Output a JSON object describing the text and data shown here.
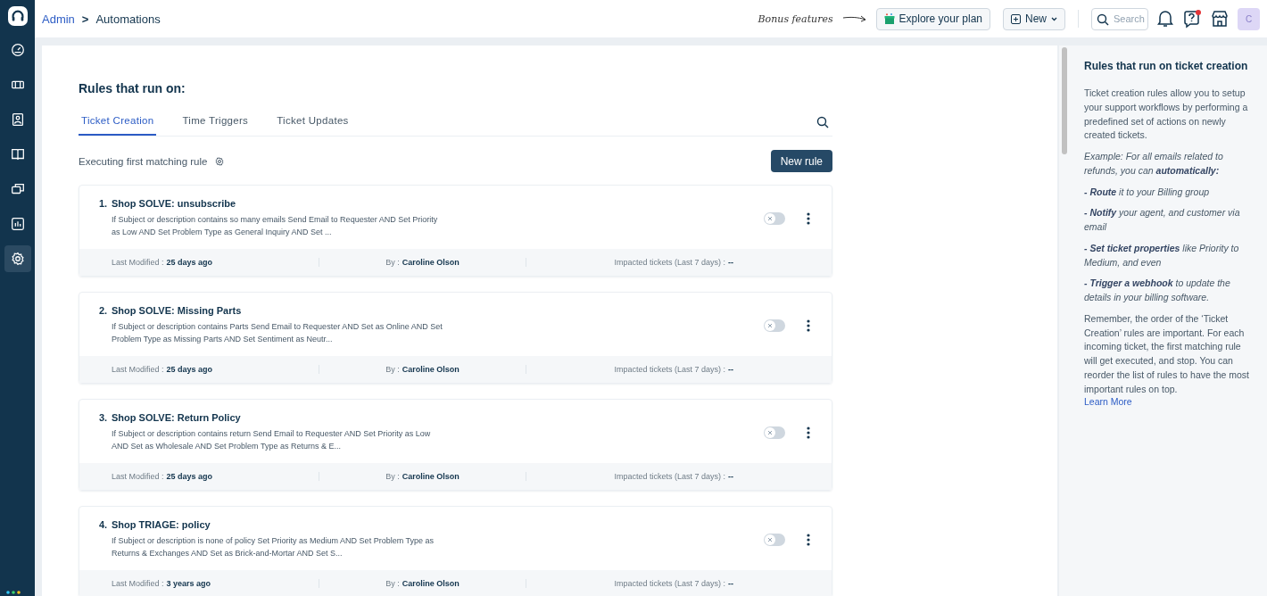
{
  "sidebar": {
    "items": [
      {
        "selected": false
      },
      {
        "selected": false
      },
      {
        "selected": false
      },
      {
        "selected": false
      },
      {
        "selected": false
      },
      {
        "selected": false
      },
      {
        "selected": true
      }
    ]
  },
  "breadcrumb": {
    "parent": "Admin",
    "separator": ">",
    "current": "Automations"
  },
  "header": {
    "hint": "Bonus features",
    "explore_button": "Explore your plan",
    "new_button": "New",
    "search": {
      "placeholder": "Search"
    },
    "help_badge": true,
    "avatar": "C"
  },
  "main": {
    "heading": "Rules that run on:",
    "tabs": [
      {
        "label": "Ticket Creation",
        "selected": true
      },
      {
        "label": "Time Triggers",
        "selected": false
      },
      {
        "label": "Ticket Updates",
        "selected": false
      }
    ],
    "mode": "Executing first matching rule",
    "new_rule_button": "New rule",
    "rules": [
      {
        "number": "1.",
        "name": "Shop SOLVE: unsubscribe",
        "description": "If Subject or description contains so many emails Send Email to Requester AND Set Priority as Low AND Set Problem Type as General Inquiry AND Set ...",
        "on": false,
        "modified_label": "Last Modified :",
        "modified": "25 days ago",
        "by_label": "By :",
        "by": "Caroline Olson",
        "impact_label": "Impacted tickets (Last 7 days) :",
        "impact": "--"
      },
      {
        "number": "2.",
        "name": "Shop SOLVE: Missing Parts",
        "description": "If Subject or description contains Parts Send Email to Requester AND Set as Online AND Set Problem Type as Missing Parts AND Set Sentiment as Neutr...",
        "on": false,
        "modified_label": "Last Modified :",
        "modified": "25 days ago",
        "by_label": "By :",
        "by": "Caroline Olson",
        "impact_label": "Impacted tickets (Last 7 days) :",
        "impact": "--"
      },
      {
        "number": "3.",
        "name": "Shop SOLVE: Return Policy",
        "description": "If Subject or description contains return Send Email to Requester AND Set Priority as Low AND Set as Wholesale AND Set Problem Type as Returns & E...",
        "on": false,
        "modified_label": "Last Modified :",
        "modified": "25 days ago",
        "by_label": "By :",
        "by": "Caroline Olson",
        "impact_label": "Impacted tickets (Last 7 days) :",
        "impact": "--"
      },
      {
        "number": "4.",
        "name": "Shop TRIAGE: policy",
        "description": "If Subject or description is none of policy Set Priority as Medium AND Set Problem Type as Returns & Exchanges AND Set as Brick-and-Mortar AND Set S...",
        "on": false,
        "modified_label": "Last Modified :",
        "modified": "3 years ago",
        "by_label": "By :",
        "by": "Caroline Olson",
        "impact_label": "Impacted tickets (Last 7 days) :",
        "impact": "--"
      }
    ]
  },
  "help_panel": {
    "title": "Rules that run on ticket creation",
    "paragraphs": [
      {
        "kind": "plain",
        "text": "Ticket creation rules allow you to setup your support workflows by performing a predefined set of actions on newly created tickets."
      },
      {
        "kind": "example",
        "text": "Example: For all emails related to refunds, you can **automatically:**"
      },
      {
        "kind": "example",
        "text": "**- Route** it to your Billing group"
      },
      {
        "kind": "example",
        "text": "**- Notify** your agent, and customer via email"
      },
      {
        "kind": "example",
        "text": "**- Set ticket properties** like Priority to Medium, and even"
      },
      {
        "kind": "example",
        "text": "**- Trigger a webhook** to update the details in your billing software."
      },
      {
        "kind": "plain",
        "text": "Remember, the order of the ‘Ticket Creation’ rules are important. For each incoming ticket, the first matching rule will get executed, and stop. You can reorder the list of rules to have the most important rules on top."
      }
    ],
    "link": "Learn More"
  }
}
